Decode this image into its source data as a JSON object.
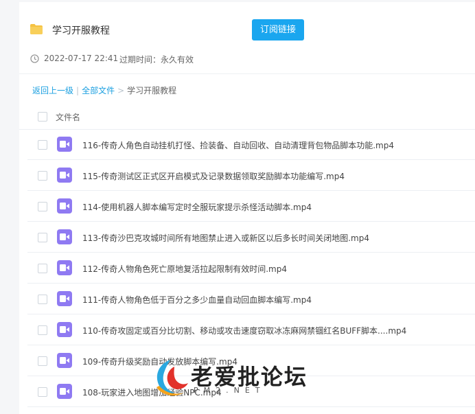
{
  "share": {
    "title": "学习开服教程",
    "subscribe_label": "订阅链接",
    "date": "2022-07-17 22:41",
    "expire": "过期时间：永久有效"
  },
  "breadcrumb": {
    "back": "返回上一级",
    "sep1": "|",
    "all": "全部文件",
    "sep2": ">",
    "current": "学习开服教程"
  },
  "list": {
    "header": "文件名",
    "files": [
      "116-传奇人角色自动挂机打怪、捡装备、自动回收、自动清理背包物品脚本功能.mp4",
      "115-传奇测试区正式区开启模式及记录数据领取奖励脚本功能编写.mp4",
      "114-使用机器人脚本编写定时全服玩家提示杀怪活动脚本.mp4",
      "113-传奇沙巴克攻城时间所有地图禁止进入或新区以后多长时间关闭地图.mp4",
      "112-传奇人物角色死亡原地复活拉起限制有效时间.mp4",
      "111-传奇人物角色低于百分之多少血量自动回血脚本编写.mp4",
      "110-传奇攻固定或百分比切割、移动或攻击速度窃取冰冻麻网禁锢红名BUFF脚本....mp4",
      "109-传奇升级奖励自动发放脚本编写.mp4",
      "108-玩家进入地图增加经验NPC.mp4"
    ]
  },
  "watermark": {
    "text": "老爱批论坛",
    "sub": "PM2.NET"
  },
  "colors": {
    "accent": "#1aa6ef",
    "video_icon": "#8f7af2",
    "folder": "#f5c242"
  }
}
